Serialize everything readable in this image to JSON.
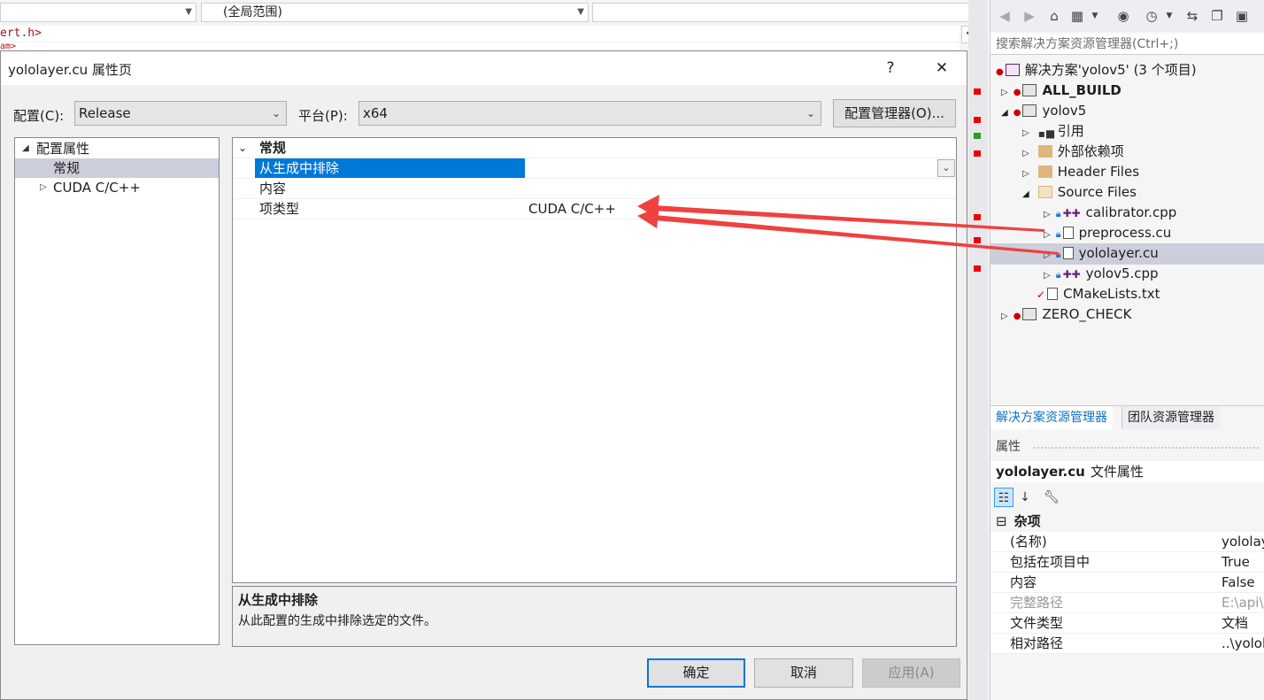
{
  "editor": {
    "nav_scope": "(全局范围)",
    "code_fragment": "ert.h>",
    "code_fragment2": "am>"
  },
  "dialog": {
    "title": "yololayer.cu 属性页",
    "help_label": "?",
    "close_label": "✕",
    "config_label": "配置(C):",
    "config_value": "Release",
    "platform_label": "平台(P):",
    "platform_value": "x64",
    "config_manager_label": "配置管理器(O)...",
    "tree": {
      "root": "配置属性",
      "general": "常规",
      "cuda": "CUDA C/C++"
    },
    "grid": {
      "category": "常规",
      "rows": [
        {
          "name": "从生成中排除",
          "value": ""
        },
        {
          "name": "内容",
          "value": ""
        },
        {
          "name": "项类型",
          "value": "CUDA C/C++"
        }
      ]
    },
    "description": {
      "title": "从生成中排除",
      "text": "从此配置的生成中排除选定的文件。"
    },
    "ok_label": "确定",
    "cancel_label": "取消",
    "apply_label": "应用(A)"
  },
  "solution_explorer": {
    "search_placeholder": "搜索解决方案资源管理器(Ctrl+;)",
    "solution": "解决方案'yolov5' (3 个项目)",
    "items": {
      "all_build": "ALL_BUILD",
      "yolov5": "yolov5",
      "references": "引用",
      "external_deps": "外部依赖项",
      "header_files": "Header Files",
      "source_files": "Source Files",
      "calibrator": "calibrator.cpp",
      "preprocess": "preprocess.cu",
      "yololayer": "yololayer.cu",
      "yolov5cpp": "yolov5.cpp",
      "cmakelists": "CMakeLists.txt",
      "zero_check": "ZERO_CHECK"
    },
    "tabs": {
      "solution_explorer": "解决方案资源管理器",
      "team_explorer": "团队资源管理器"
    }
  },
  "properties": {
    "header": "属性",
    "object_name": "yololayer.cu",
    "object_type": "文件属性",
    "category": "杂项",
    "rows": [
      {
        "name": "(名称)",
        "value": "yololay"
      },
      {
        "name": "包括在项目中",
        "value": "True"
      },
      {
        "name": "内容",
        "value": "False"
      },
      {
        "name": "完整路径",
        "value": "E:\\api\\"
      },
      {
        "name": "文件类型",
        "value": "文档"
      },
      {
        "name": "相对路径",
        "value": "..\\yolol"
      }
    ]
  },
  "colors": {
    "accent": "#0078d7",
    "annotation_arrow": "#f04040",
    "selection": "#cccedb"
  }
}
